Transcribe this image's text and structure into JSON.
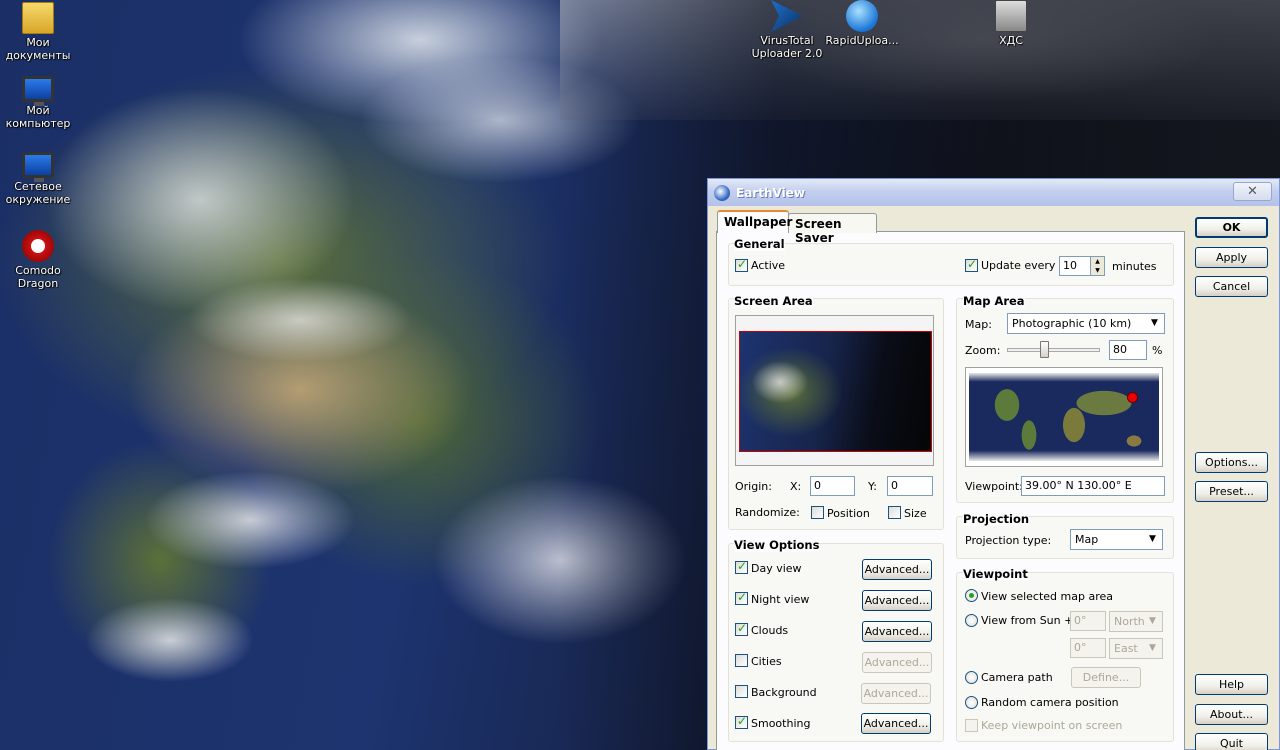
{
  "desktop": {
    "icons": [
      {
        "label": "Мои документы",
        "icon": "folder-icon"
      },
      {
        "label": "Мой компьютер",
        "icon": "computer-icon"
      },
      {
        "label": "Сетевое окружение",
        "icon": "network-icon"
      },
      {
        "label": "Comodo Dragon",
        "icon": "browser-icon"
      },
      {
        "label": "VirusTotal Uploader 2.0",
        "icon": "virustotal-icon"
      },
      {
        "label": "RapidUploa...",
        "icon": "upload-icon"
      },
      {
        "label": "ХДС",
        "icon": "program-icon"
      }
    ]
  },
  "window": {
    "title": "EarthView",
    "close_glyph": "✕"
  },
  "tabs": [
    {
      "label": "Wallpaper",
      "active": true
    },
    {
      "label": "Screen Saver",
      "active": false
    }
  ],
  "general": {
    "title": "General",
    "active_label": "Active",
    "active_checked": true,
    "update_label": "Update every",
    "update_checked": true,
    "update_value": "10",
    "update_unit": "minutes"
  },
  "screen_area": {
    "title": "Screen Area",
    "origin_label": "Origin:",
    "x_label": "X:",
    "x_value": "0",
    "y_label": "Y:",
    "y_value": "0",
    "randomize_label": "Randomize:",
    "position_label": "Position",
    "size_label": "Size"
  },
  "map_area": {
    "title": "Map Area",
    "map_label": "Map:",
    "map_value": "Photographic (10 km)",
    "zoom_label": "Zoom:",
    "zoom_value": "80",
    "zoom_unit": "%",
    "viewpoint_label": "Viewpoint:",
    "viewpoint_value": "39.00° N   130.00° E"
  },
  "view_options": {
    "title": "View Options",
    "advanced_label": "Advanced...",
    "items": [
      {
        "label": "Day view",
        "checked": true,
        "enabled": true
      },
      {
        "label": "Night view",
        "checked": true,
        "enabled": true
      },
      {
        "label": "Clouds",
        "checked": true,
        "enabled": true
      },
      {
        "label": "Cities",
        "checked": false,
        "enabled": false
      },
      {
        "label": "Background",
        "checked": false,
        "enabled": false
      },
      {
        "label": "Smoothing",
        "checked": true,
        "enabled": true
      }
    ]
  },
  "projection": {
    "title": "Projection",
    "type_label": "Projection type:",
    "type_value": "Map"
  },
  "viewpoint": {
    "title": "Viewpoint",
    "view_selected": "View selected map area",
    "view_from_sun": "View from Sun +",
    "lat_value": "0°",
    "lat_dir": "North",
    "lon_value": "0°",
    "lon_dir": "East",
    "camera_path": "Camera path",
    "define_label": "Define...",
    "random_camera": "Random camera position",
    "keep_viewpoint": "Keep viewpoint on screen"
  },
  "buttons": {
    "ok": "OK",
    "apply": "Apply",
    "cancel": "Cancel",
    "options": "Options...",
    "preset": "Preset...",
    "help": "Help",
    "about": "About...",
    "quit": "Quit"
  }
}
